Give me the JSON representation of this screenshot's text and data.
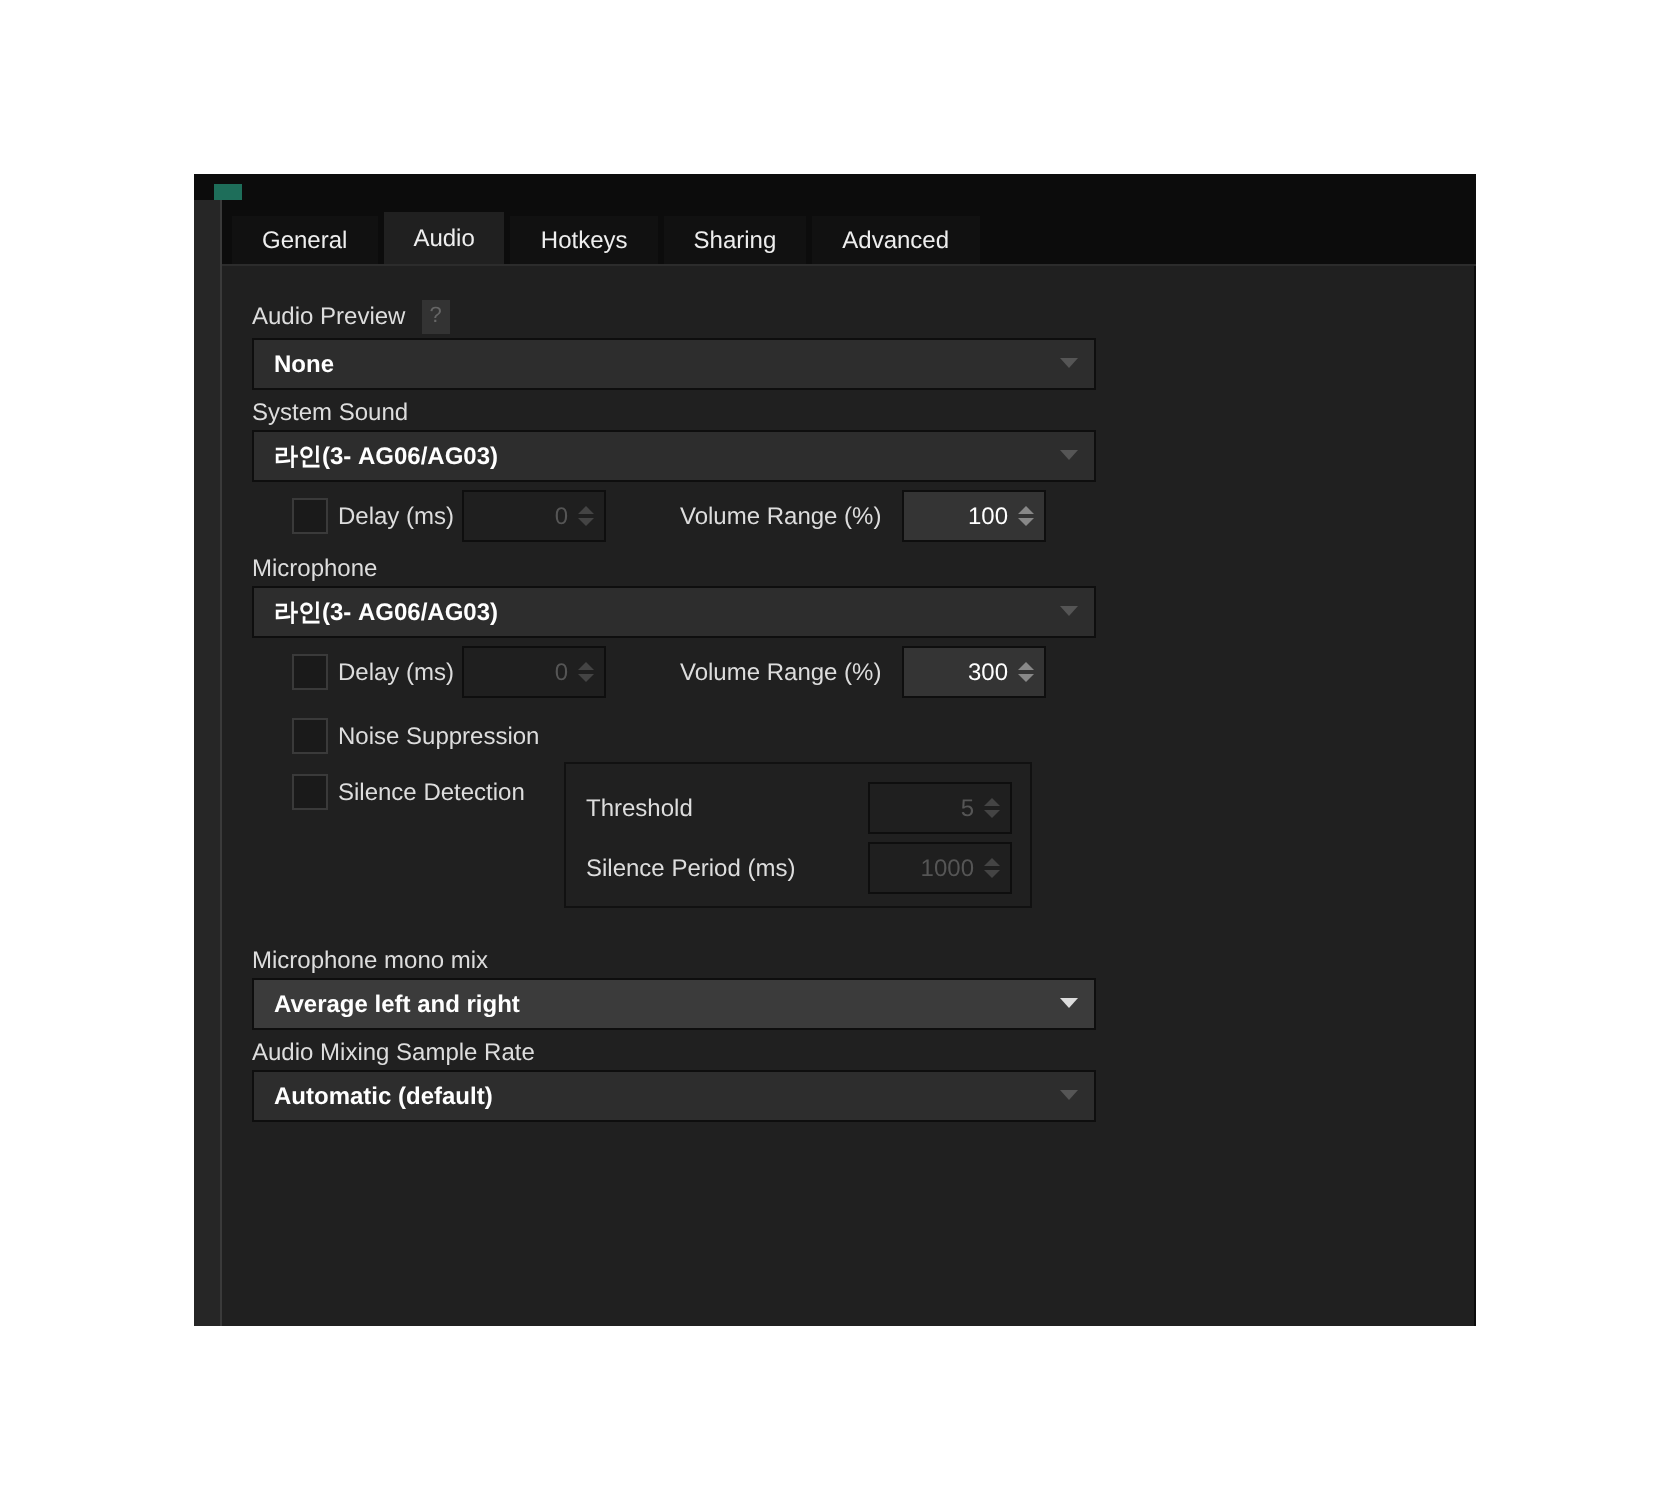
{
  "tabs": [
    {
      "label": "General",
      "selected": false
    },
    {
      "label": "Audio",
      "selected": true
    },
    {
      "label": "Hotkeys",
      "selected": false
    },
    {
      "label": "Sharing",
      "selected": false
    },
    {
      "label": "Advanced",
      "selected": false
    }
  ],
  "audio_preview": {
    "label": "Audio Preview",
    "help": "?",
    "dropdown": {
      "value": "None",
      "disabled": true
    }
  },
  "system_sound": {
    "label": "System Sound",
    "dropdown": {
      "value": "라인(3- AG06/AG03)",
      "disabled": true
    },
    "delay": {
      "label": "Delay (ms)",
      "checked": false,
      "value": "0",
      "disabled": true
    },
    "volume_range": {
      "label": "Volume Range (%)",
      "value": "100",
      "disabled": false
    }
  },
  "microphone": {
    "label": "Microphone",
    "dropdown": {
      "value": "라인(3- AG06/AG03)",
      "disabled": true
    },
    "delay": {
      "label": "Delay (ms)",
      "checked": false,
      "value": "0",
      "disabled": true
    },
    "volume_range": {
      "label": "Volume Range (%)",
      "value": "300",
      "disabled": false
    },
    "noise_suppression": {
      "label": "Noise Suppression",
      "checked": false
    },
    "silence_detection": {
      "label": "Silence Detection",
      "checked": false,
      "threshold": {
        "label": "Threshold",
        "value": "5",
        "disabled": true
      },
      "silence_period": {
        "label": "Silence Period (ms)",
        "value": "1000",
        "disabled": true
      }
    }
  },
  "mono_mix": {
    "label": "Microphone mono mix",
    "dropdown": {
      "value": "Average left and right",
      "disabled": false
    }
  },
  "sample_rate": {
    "label": "Audio Mixing Sample Rate",
    "dropdown": {
      "value": "Automatic (default)",
      "disabled": true
    }
  }
}
